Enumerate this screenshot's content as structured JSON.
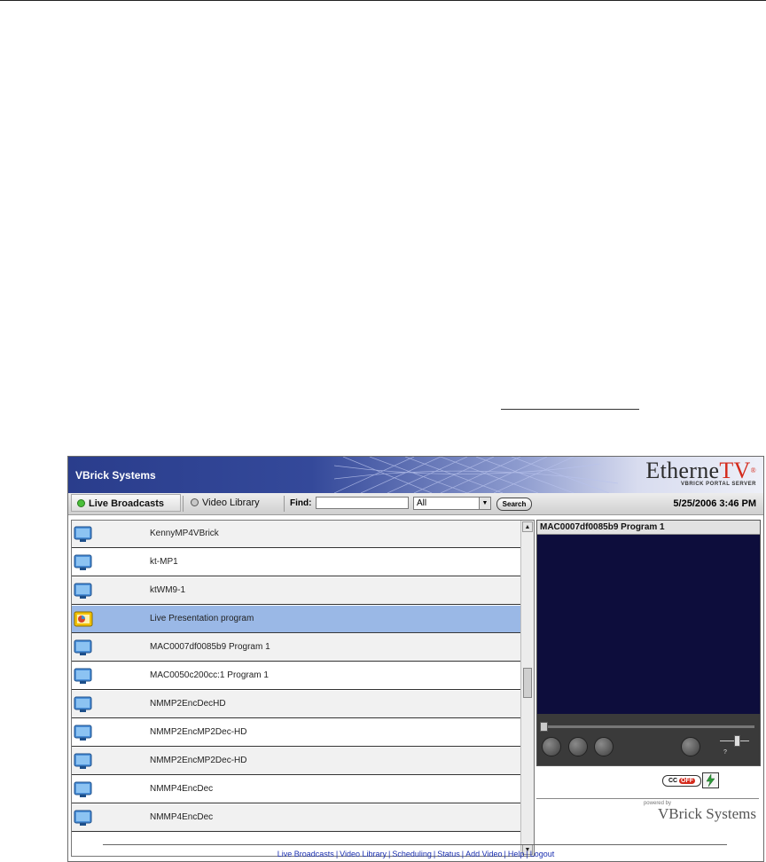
{
  "app": {
    "brand": "VBrick Systems",
    "logo_main": "Etherne",
    "logo_accent": "TV",
    "logo_reg": "®",
    "logo_sub": "VBRICK PORTAL SERVER"
  },
  "toolbar": {
    "tab_live": "Live Broadcasts",
    "tab_library": "Video Library",
    "find_label": "Find:",
    "find_value": "",
    "find_select_value": "All",
    "search_label": "Search",
    "datetime": "5/25/2006 3:46 PM"
  },
  "list": {
    "items": [
      {
        "label": "KennyMP4VBrick",
        "icon": "monitor-icon"
      },
      {
        "label": "kt-MP1",
        "icon": "monitor-icon"
      },
      {
        "label": "ktWM9-1",
        "icon": "monitor-icon"
      },
      {
        "label": "Live Presentation program",
        "icon": "presentation-icon",
        "selected": true
      },
      {
        "label": "MAC0007df0085b9 Program 1",
        "icon": "monitor-icon"
      },
      {
        "label": "MAC0050c200cc:1 Program 1",
        "icon": "monitor-icon"
      },
      {
        "label": "NMMP2EncDecHD",
        "icon": "monitor-icon"
      },
      {
        "label": "NMMP2EncMP2Dec-HD",
        "icon": "monitor-icon"
      },
      {
        "label": "NMMP2EncMP2Dec-HD",
        "icon": "monitor-icon"
      },
      {
        "label": "NMMP4EncDec",
        "icon": "monitor-icon"
      },
      {
        "label": "NMMP4EncDec",
        "icon": "monitor-icon"
      }
    ]
  },
  "player": {
    "title": "MAC0007df0085b9 Program 1",
    "volume_mark": "?",
    "cc_label": "CC",
    "cc_state": "OFF"
  },
  "powered": {
    "small": "powered by",
    "main": "VBrick Systems"
  },
  "footer": {
    "links": [
      "Live Broadcasts",
      "Video Library",
      "Scheduling",
      "Status",
      "Add Video",
      "Help",
      "Logout"
    ]
  },
  "colors": {
    "banner": "#2a3d8c",
    "selected_row": "#9ab8e6",
    "video_bg": "#0d0d3c",
    "link": "#1a2fb0",
    "accent_red": "#d42a1c"
  }
}
